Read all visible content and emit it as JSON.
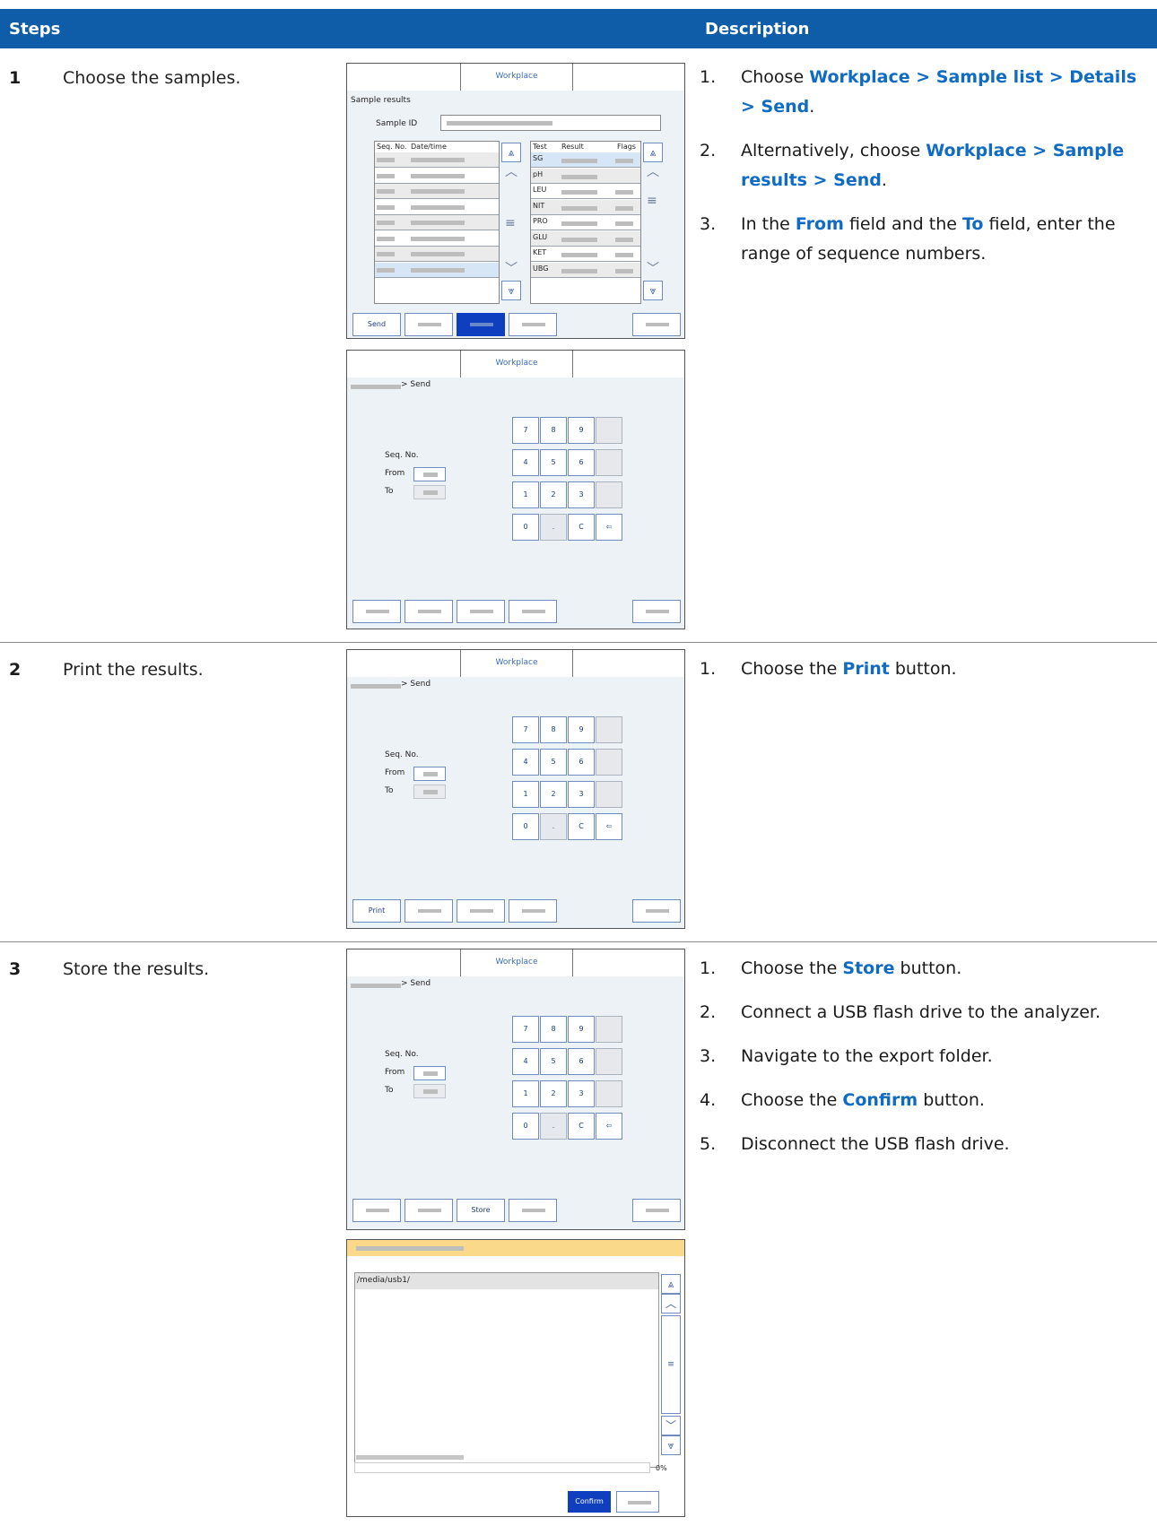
{
  "header": {
    "steps_label": "Steps",
    "description_label": "Description"
  },
  "steps": [
    {
      "number": "1",
      "text": "Choose the samples.",
      "items": [
        {
          "n": "1.",
          "parts": [
            {
              "t": "Choose "
            },
            {
              "t": "Workplace > Sample list > Details > Send",
              "b": true
            },
            {
              "t": "."
            }
          ]
        },
        {
          "n": "2.",
          "parts": [
            {
              "t": "Alternatively, choose "
            },
            {
              "t": "Workplace > Sample results > Send",
              "b": true
            },
            {
              "t": "."
            }
          ]
        },
        {
          "n": "3.",
          "parts": [
            {
              "t": "In the "
            },
            {
              "t": "From",
              "b": true
            },
            {
              "t": " field and the "
            },
            {
              "t": "To",
              "b": true
            },
            {
              "t": " field, enter the range of sequence numbers."
            }
          ]
        }
      ]
    },
    {
      "number": "2",
      "text": "Print the results.",
      "items": [
        {
          "n": "1.",
          "parts": [
            {
              "t": "Choose the "
            },
            {
              "t": "Print",
              "b": true
            },
            {
              "t": " button."
            }
          ]
        }
      ]
    },
    {
      "number": "3",
      "text": "Store the results.",
      "items": [
        {
          "n": "1.",
          "parts": [
            {
              "t": "Choose the "
            },
            {
              "t": "Store",
              "b": true
            },
            {
              "t": " button."
            }
          ]
        },
        {
          "n": "2.",
          "parts": [
            {
              "t": "Connect a USB flash drive to the analyzer."
            }
          ]
        },
        {
          "n": "3.",
          "parts": [
            {
              "t": "Navigate to the export folder."
            }
          ]
        },
        {
          "n": "4.",
          "parts": [
            {
              "t": "Choose the "
            },
            {
              "t": "Confirm",
              "b": true
            },
            {
              "t": " button."
            }
          ]
        },
        {
          "n": "5.",
          "parts": [
            {
              "t": "Disconnect the USB flash drive."
            }
          ]
        }
      ]
    }
  ],
  "screens": {
    "results": {
      "tab": "Workplace",
      "title": "Sample results",
      "sample_id_label": "Sample ID",
      "left_headers": [
        "Seq. No.",
        "Date/time"
      ],
      "right_headers": [
        "Test",
        "Result",
        "Flags"
      ],
      "tests": [
        "SG",
        "pH",
        "LEU",
        "NIT",
        "PRO",
        "GLU",
        "KET",
        "UBG"
      ],
      "send_button": "Send"
    },
    "send": {
      "tab": "Workplace",
      "breadcrumb_suffix": "> Send",
      "seq_label": "Seq. No.",
      "from_label": "From",
      "to_label": "To",
      "keypad": [
        "7",
        "8",
        "9",
        "",
        "4",
        "5",
        "6",
        "",
        "1",
        "2",
        "3",
        "",
        "0",
        ".",
        "C",
        "⇦"
      ]
    },
    "print_button": "Print",
    "store_button": "Store",
    "usb": {
      "path": "/media/usb1/",
      "progress": "0%",
      "confirm_button": "Confirm"
    }
  }
}
